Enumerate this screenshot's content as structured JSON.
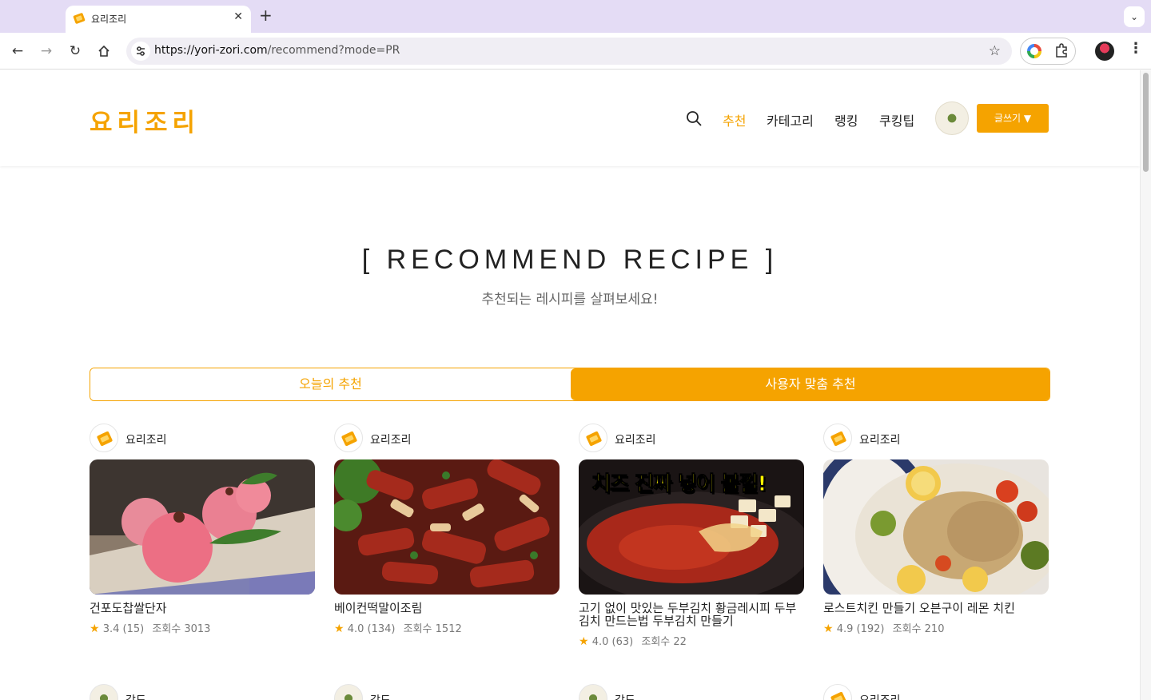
{
  "browser": {
    "tab_title": "요리조리",
    "url_host": "https://yori-zori.com",
    "url_path": "/recommend?mode=PR"
  },
  "header": {
    "logo": "요리조리",
    "nav": [
      "추천",
      "카테고리",
      "랭킹",
      "쿠킹팁"
    ],
    "active_nav": "추천",
    "write_button": "글쓰기 ▼"
  },
  "hero": {
    "title": "[ RECOMMEND RECIPE ]",
    "subtitle": "추천되는 레시피를 살펴보세요!"
  },
  "tabs": {
    "today": "오늘의 추천",
    "user": "사용자 맞춤 추천",
    "selected": "사용자 맞춤 추천"
  },
  "cards": [
    {
      "author": "요리조리",
      "title": "건포도찹쌀단자",
      "rating": "3.4",
      "reviews": "(15)",
      "views": "조회수 3013"
    },
    {
      "author": "요리조리",
      "title": "베이컨떡말이조림",
      "rating": "4.0",
      "reviews": "(134)",
      "views": "조회수 1512"
    },
    {
      "author": "요리조리",
      "title": "고기 없이 맛있는 두부김치 황금레시피 두부김치 만드는법 두부김치 만들기",
      "rating": "4.0",
      "reviews": "(63)",
      "views": "조회수 22",
      "image_caption": "치즈 진짜 넣어 볼껄!"
    },
    {
      "author": "요리조리",
      "title": "로스트치킨 만들기 오븐구이 레몬 치킨",
      "rating": "4.9",
      "reviews": "(192)",
      "views": "조회수 210"
    }
  ],
  "next_row_authors": [
    "감도",
    "감도",
    "감도",
    "요리조리"
  ],
  "colors": {
    "accent": "#f5a300",
    "browser_tabbar": "#e4dcf5"
  }
}
